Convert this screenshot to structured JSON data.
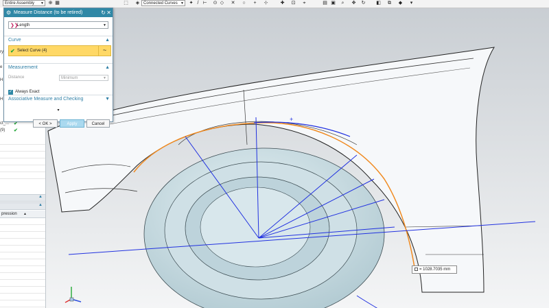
{
  "toolbar": {
    "assembly_filter": "Entire Assembly",
    "curve_rule": "Connected Curves"
  },
  "left_panel": {
    "fragments": [
      "ry",
      "e",
      "H",
      "H",
      "ct_...",
      "(9)"
    ],
    "column_header": "pression"
  },
  "dialog": {
    "title": "Measure Distance (to be retired)",
    "type_value": "Length",
    "curve_section": "Curve",
    "select_curve": "Select Curve (4)",
    "measurement_section": "Measurement",
    "distance_label": "Distance",
    "distance_value": "Minimum",
    "always_exact": "Always Exact",
    "associative_section": "Associative Measure and Checking",
    "ok_button": "< OK >",
    "apply_button": "Apply",
    "cancel_button": "Cancel"
  },
  "measurement_result": "= 1028.7035 mm",
  "colors": {
    "dialog_header": "#2f88a6",
    "selection_highlight": "#ffd866",
    "measure_lines": "#2030e0",
    "selected_curve": "#f08a20",
    "tire": "#bcd4dc"
  }
}
